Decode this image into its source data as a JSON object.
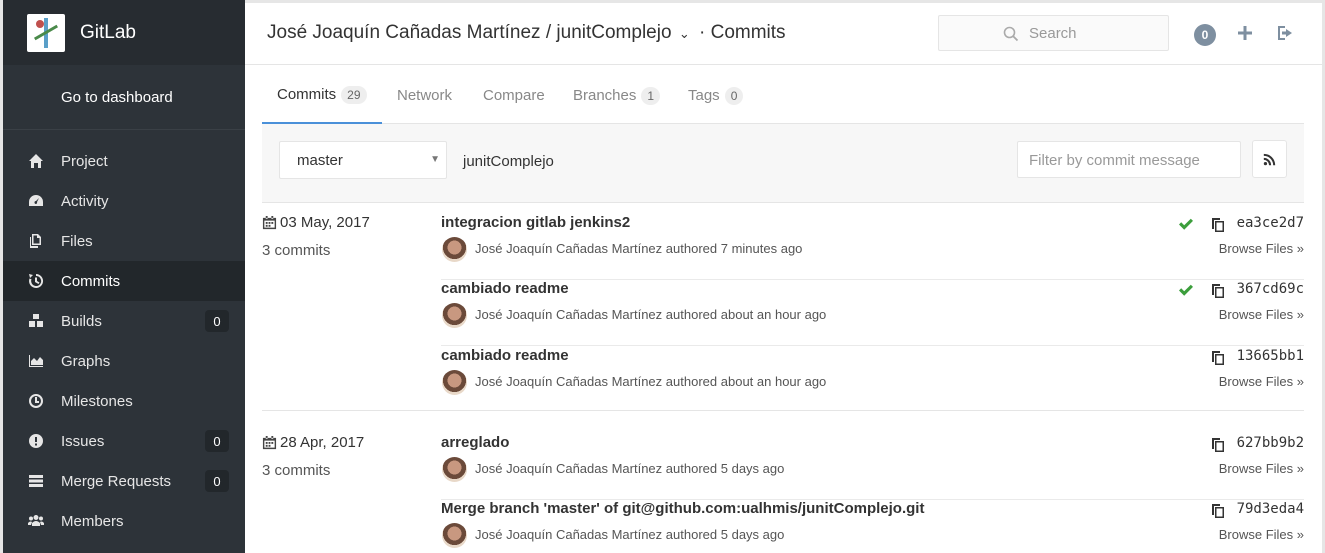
{
  "brand": {
    "title": "GitLab"
  },
  "sidebar": {
    "dashboard_link": "Go to dashboard",
    "items": [
      {
        "label": "Project",
        "icon": "home-icon",
        "badge": null,
        "active": false
      },
      {
        "label": "Activity",
        "icon": "dashboard-icon",
        "badge": null,
        "active": false
      },
      {
        "label": "Files",
        "icon": "files-icon",
        "badge": null,
        "active": false
      },
      {
        "label": "Commits",
        "icon": "history-icon",
        "badge": null,
        "active": true
      },
      {
        "label": "Builds",
        "icon": "cubes-icon",
        "badge": "0",
        "active": false
      },
      {
        "label": "Graphs",
        "icon": "area-chart-icon",
        "badge": null,
        "active": false
      },
      {
        "label": "Milestones",
        "icon": "clock-icon",
        "badge": null,
        "active": false
      },
      {
        "label": "Issues",
        "icon": "exclamation-circle-icon",
        "badge": "0",
        "active": false
      },
      {
        "label": "Merge Requests",
        "icon": "tasks-icon",
        "badge": "0",
        "active": false
      },
      {
        "label": "Members",
        "icon": "users-icon",
        "badge": null,
        "active": false
      }
    ]
  },
  "header": {
    "owner": "José Joaquín Cañadas Martínez",
    "separator": "/",
    "project": "junitComplejo",
    "section": "· Commits",
    "search_placeholder": "Search",
    "todo_count": "0"
  },
  "tabs": [
    {
      "label": "Commits",
      "count": "29",
      "active": true
    },
    {
      "label": "Network",
      "count": null,
      "active": false
    },
    {
      "label": "Compare",
      "count": null,
      "active": false
    },
    {
      "label": "Branches",
      "count": "1",
      "active": false
    },
    {
      "label": "Tags",
      "count": "0",
      "active": false
    }
  ],
  "filterbar": {
    "branch": "master",
    "repo_name": "junitComplejo",
    "filter_placeholder": "Filter by commit message"
  },
  "days": [
    {
      "date": "03 May, 2017",
      "count_label": "3 commits",
      "commits": [
        {
          "title": "integracion gitlab jenkins2",
          "author": "José Joaquín Cañadas Martínez",
          "verb": "authored",
          "time": "7 minutes ago",
          "status_passed": true,
          "sha": "ea3ce2d7",
          "browse": "Browse Files »"
        },
        {
          "title": "cambiado readme",
          "author": "José Joaquín Cañadas Martínez",
          "verb": "authored",
          "time": "about an hour ago",
          "status_passed": true,
          "sha": "367cd69c",
          "browse": "Browse Files »"
        },
        {
          "title": "cambiado readme",
          "author": "José Joaquín Cañadas Martínez",
          "verb": "authored",
          "time": "about an hour ago",
          "status_passed": false,
          "sha": "13665bb1",
          "browse": "Browse Files »"
        }
      ]
    },
    {
      "date": "28 Apr, 2017",
      "count_label": "3 commits",
      "commits": [
        {
          "title": "arreglado",
          "author": "José Joaquín Cañadas Martínez",
          "verb": "authored",
          "time": "5 days ago",
          "status_passed": false,
          "sha": "627bb9b2",
          "browse": "Browse Files »"
        },
        {
          "title": "Merge branch 'master' of git@github.com:ualhmis/junitComplejo.git",
          "author": "José Joaquín Cañadas Martínez",
          "verb": "authored",
          "time": "5 days ago",
          "status_passed": false,
          "sha": "79d3eda4",
          "browse": "Browse Files »"
        }
      ]
    }
  ]
}
